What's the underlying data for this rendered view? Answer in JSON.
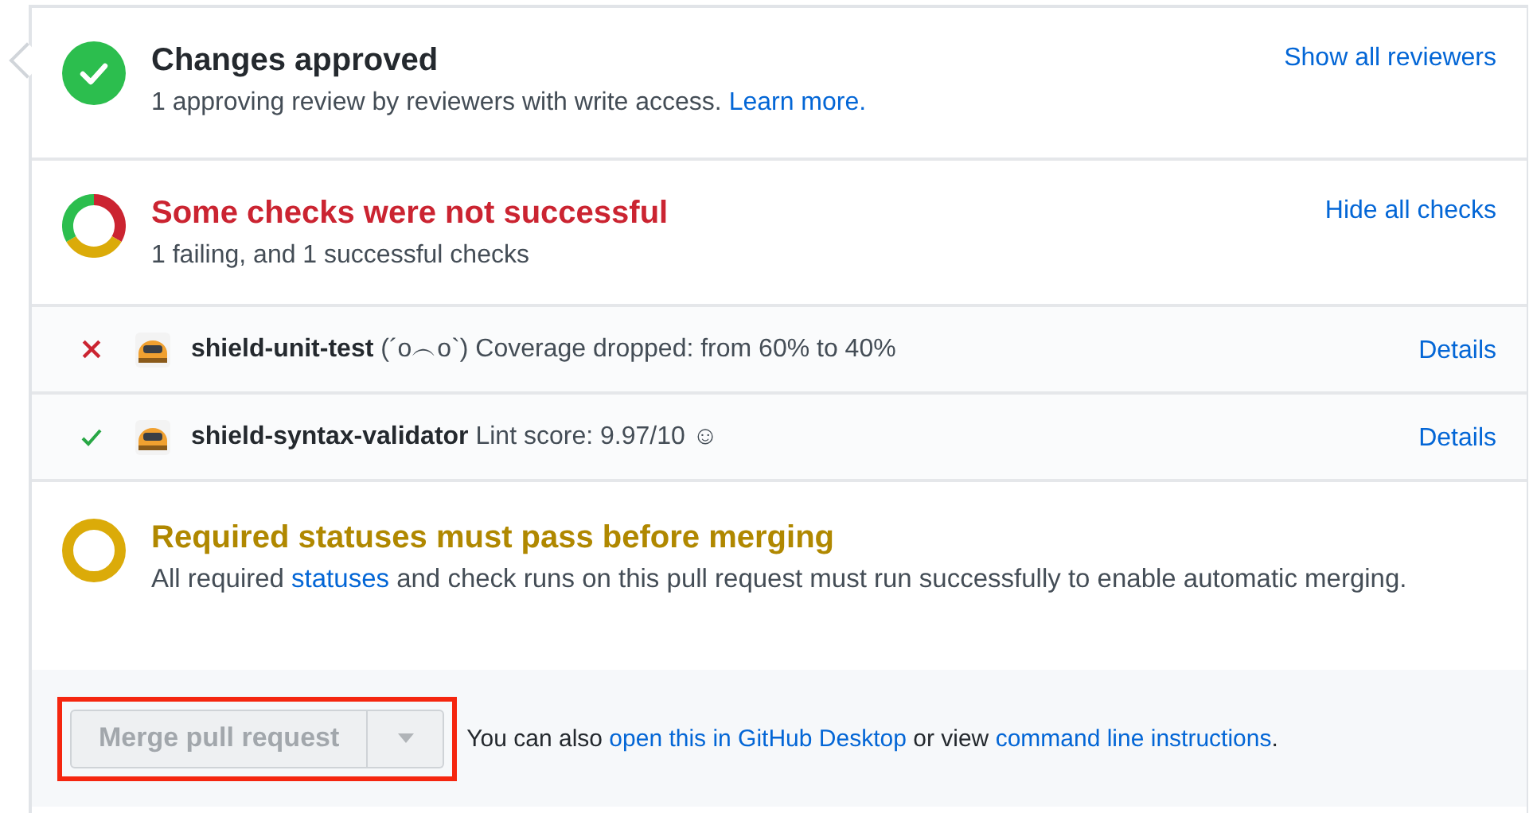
{
  "reviews": {
    "kind": "approved",
    "title": "Changes approved",
    "description": [
      {
        "text": "1 approving review by reviewers with write access. "
      },
      {
        "text": "Learn more.",
        "link": true
      }
    ],
    "action": "Show all reviewers"
  },
  "checks": {
    "kind": "mixed",
    "title": "Some checks were not successful",
    "description": [
      {
        "text": "1 failing, and 1 successful checks"
      }
    ],
    "action": "Hide all checks",
    "items": [
      {
        "kind": "failure",
        "name": "shield-unit-test",
        "message": "(´o︵o`) Coverage dropped: from 60% to 40%",
        "action": "Details"
      },
      {
        "kind": "success",
        "name": "shield-syntax-validator",
        "message": "Lint score: 9.97/10 ☺",
        "action": "Details"
      }
    ]
  },
  "required": {
    "kind": "pending",
    "title": "Required statuses must pass before merging",
    "description": [
      {
        "text": "All required "
      },
      {
        "text": "statuses",
        "link": true
      },
      {
        "text": " and check runs on this pull request must run successfully to enable automatic merging."
      }
    ]
  },
  "merge": {
    "button": "Merge pull request",
    "disabled": true,
    "highlighted": true,
    "note": [
      {
        "text": "You can also "
      },
      {
        "text": "open this in GitHub Desktop",
        "link": true
      },
      {
        "text": " or view "
      },
      {
        "text": "command line instructions",
        "link": true
      },
      {
        "text": "."
      }
    ]
  }
}
